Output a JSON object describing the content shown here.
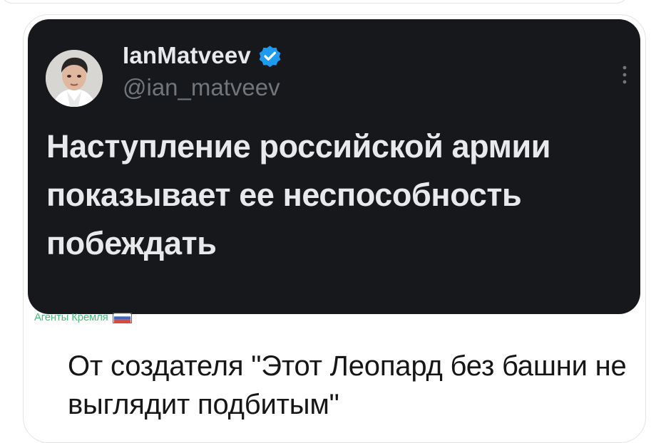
{
  "tweet": {
    "author_name": "IanMatveev",
    "handle": "@ian_matveev",
    "text": "Наступление российской армии показывает ее неспособность побеждать"
  },
  "watermark": {
    "text": "Агенты Кремля",
    "flag_icon": "russia-flag-icon"
  },
  "caption": {
    "text": "От создателя \"Этот Леопард без башни не выглядит подбитым\""
  },
  "colors": {
    "tweet_background": "#16181c",
    "tweet_text": "#e7e9ea",
    "handle": "#71767b",
    "verified_badge": "#1d9bf0",
    "watermark": "#22b35f",
    "caption": "#161616"
  }
}
